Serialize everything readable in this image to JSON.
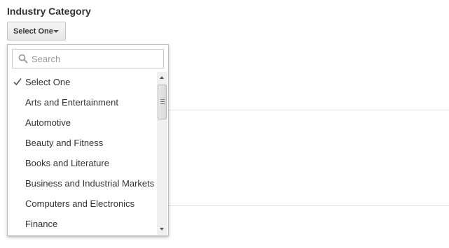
{
  "field": {
    "label": "Industry Category"
  },
  "select": {
    "value": "Select One"
  },
  "search": {
    "placeholder": "Search"
  },
  "options": [
    {
      "label": "Select One",
      "selected": true
    },
    {
      "label": "Arts and Entertainment",
      "selected": false
    },
    {
      "label": "Automotive",
      "selected": false
    },
    {
      "label": "Beauty and Fitness",
      "selected": false
    },
    {
      "label": "Books and Literature",
      "selected": false
    },
    {
      "label": "Business and Industrial Markets",
      "selected": false
    },
    {
      "label": "Computers and Electronics",
      "selected": false
    },
    {
      "label": "Finance",
      "selected": false
    }
  ],
  "icons": {
    "search": "search-icon",
    "check": "check-icon",
    "caret": "chevron-down-icon"
  },
  "colors": {
    "border": "#bdbdbd",
    "text": "#333333"
  }
}
